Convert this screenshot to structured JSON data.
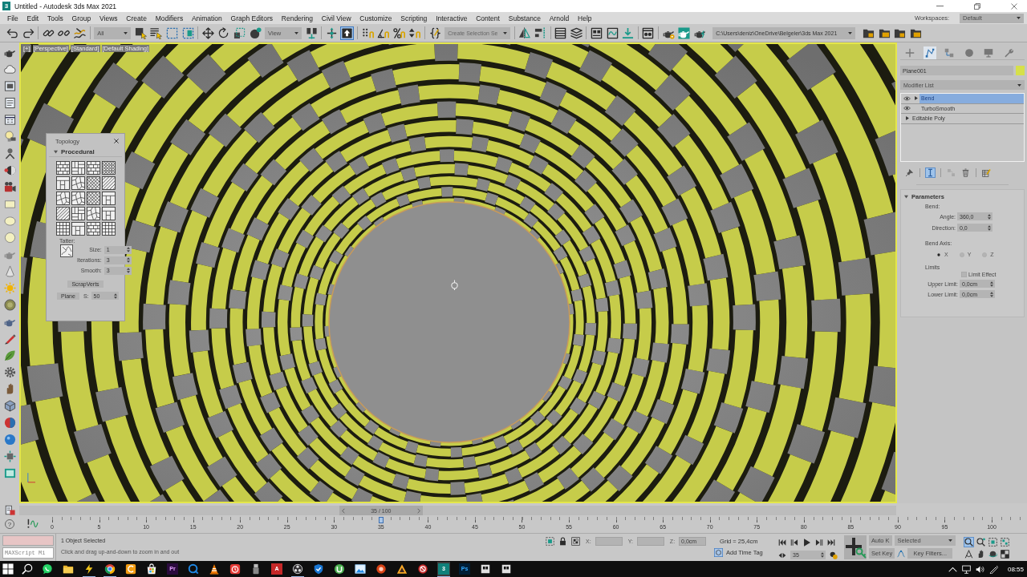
{
  "window": {
    "app_icon": "3",
    "title": "Untitled - Autodesk 3ds Max 2021"
  },
  "menu": [
    "File",
    "Edit",
    "Tools",
    "Group",
    "Views",
    "Create",
    "Modifiers",
    "Animation",
    "Graph Editors",
    "Rendering",
    "Civil View",
    "Customize",
    "Scripting",
    "Interactive",
    "Content",
    "Substance",
    "Arnold",
    "Help"
  ],
  "workspaces": {
    "label": "Workspaces:",
    "value": "Default"
  },
  "toolbar": {
    "selection_filter": "All",
    "reference_coordinate": "View",
    "keyboard_override": {
      "on": true
    },
    "named_selection": "Create Selection Se",
    "project_path": "C:\\Users\\deniz\\OneDrive\\Belgeler\\3ds Max 2021"
  },
  "viewport": {
    "active": true,
    "labels": [
      "[+]",
      "[Perspective]",
      "[Standard]",
      "[Default Shading]"
    ]
  },
  "topology": {
    "title": "Topology",
    "rollout": {
      "title": "Procedural",
      "expanded": true
    },
    "tatter_label": "Tatter:",
    "spinners": [
      {
        "label": "Size:",
        "value": "1"
      },
      {
        "label": "Iterations:",
        "value": "3"
      },
      {
        "label": "Smooth:",
        "value": "3"
      }
    ],
    "scrapverts_button": "ScrapVerts",
    "plane_button": "Plane",
    "plane_spinner": {
      "label": "S:",
      "value": "50"
    }
  },
  "command_panel": {
    "tabs": [
      {
        "selected": false
      },
      {
        "selected": true
      },
      {
        "selected": false
      },
      {
        "selected": false
      },
      {
        "selected": false
      },
      {
        "selected": false
      }
    ],
    "object_name": "Plane001",
    "modifier_list": "Modifier List",
    "stack": [
      {
        "name": "Bend",
        "kind": "modifier",
        "expandable": true,
        "selected": true
      },
      {
        "name": "TurboSmooth",
        "kind": "modifier",
        "expandable": false,
        "selected": false
      },
      {
        "name": "Editable Poly",
        "kind": "base",
        "expandable": true,
        "selected": false
      }
    ],
    "show_end_result": {
      "on": true
    },
    "make_unique": {
      "disabled": true
    },
    "parameters": {
      "title": "Parameters",
      "expanded": true,
      "bend_label": "Bend:",
      "spinners": [
        {
          "label": "Angle:",
          "value": "360,0"
        },
        {
          "label": "Direction:",
          "value": "0,0"
        }
      ],
      "axis_label": "Bend Axis:",
      "axes": [
        {
          "label": "X",
          "selected": true
        },
        {
          "label": "Y",
          "selected": false
        },
        {
          "label": "Z",
          "selected": false
        }
      ],
      "limits_label": "Limits",
      "limit_effect": {
        "label": "Limit Effect",
        "checked": false
      },
      "limit_spinners": [
        {
          "label": "Upper Limit:",
          "value": "0,0cm"
        },
        {
          "label": "Lower Limit:",
          "value": "0,0cm"
        }
      ]
    }
  },
  "time_slider": {
    "label": "35 / 100",
    "level": 0.35
  },
  "help_button": "?",
  "track_bar": {
    "labels": [
      "0",
      "5",
      "10",
      "15",
      "20",
      "25",
      "30",
      "35",
      "40",
      "45",
      "50",
      "55",
      "60",
      "65",
      "70",
      "75",
      "80",
      "85",
      "90",
      "95",
      "100"
    ]
  },
  "status": {
    "maxscript": {
      "placeholder": "MAXScript Mi"
    },
    "selection": "1 Object Selected",
    "prompt": "Click and drag up-and-down to zoom in and out",
    "coordinates": [
      {
        "label": "X:",
        "disabled": true
      },
      {
        "label": "Y:",
        "disabled": true
      },
      {
        "label": "Z:",
        "value": "0,0cm",
        "disabled": true
      }
    ],
    "grid": "Grid = 25,4cm",
    "add_time_tag": "Add Time Tag"
  },
  "animation": {
    "current_frame": "35",
    "auto_key": {
      "label": "Auto K",
      "on": false
    },
    "set_key": "Set Key",
    "key_filter_set": "Selected",
    "key_filters": "Key Filters..."
  },
  "nav_tools": [
    {
      "selected": true
    },
    {
      "selected": false
    },
    {
      "selected": false
    },
    {
      "selected": false
    },
    {
      "selected": false
    },
    {
      "selected": false
    },
    {
      "selected": false
    },
    {
      "selected": false
    }
  ],
  "taskbar": {
    "apps": [
      {
        "running": false,
        "selected": false
      },
      {
        "running": false,
        "selected": false
      },
      {
        "running": true,
        "selected": false
      },
      {
        "running": true,
        "selected": false
      },
      {
        "running": false,
        "selected": false
      },
      {
        "running": false,
        "selected": false
      },
      {
        "glyph": "Pr",
        "running": false,
        "selected": false
      },
      {
        "running": false,
        "selected": false
      },
      {
        "running": false,
        "selected": false
      },
      {
        "running": false,
        "selected": false
      },
      {
        "running": false,
        "selected": false
      },
      {
        "glyph": "A",
        "running": false,
        "selected": false
      },
      {
        "running": true,
        "selected": false
      },
      {
        "running": false,
        "selected": false
      },
      {
        "running": false,
        "selected": false
      },
      {
        "running": false,
        "selected": false
      },
      {
        "running": false,
        "selected": false
      },
      {
        "running": false,
        "selected": false
      },
      {
        "running": false,
        "selected": false
      },
      {
        "glyph": "3",
        "running": true,
        "selected": true
      },
      {
        "glyph": "Ps",
        "running": false,
        "selected": false
      },
      {
        "running": false,
        "selected": false
      },
      {
        "running": false,
        "selected": false
      }
    ],
    "clock": "08:55"
  }
}
